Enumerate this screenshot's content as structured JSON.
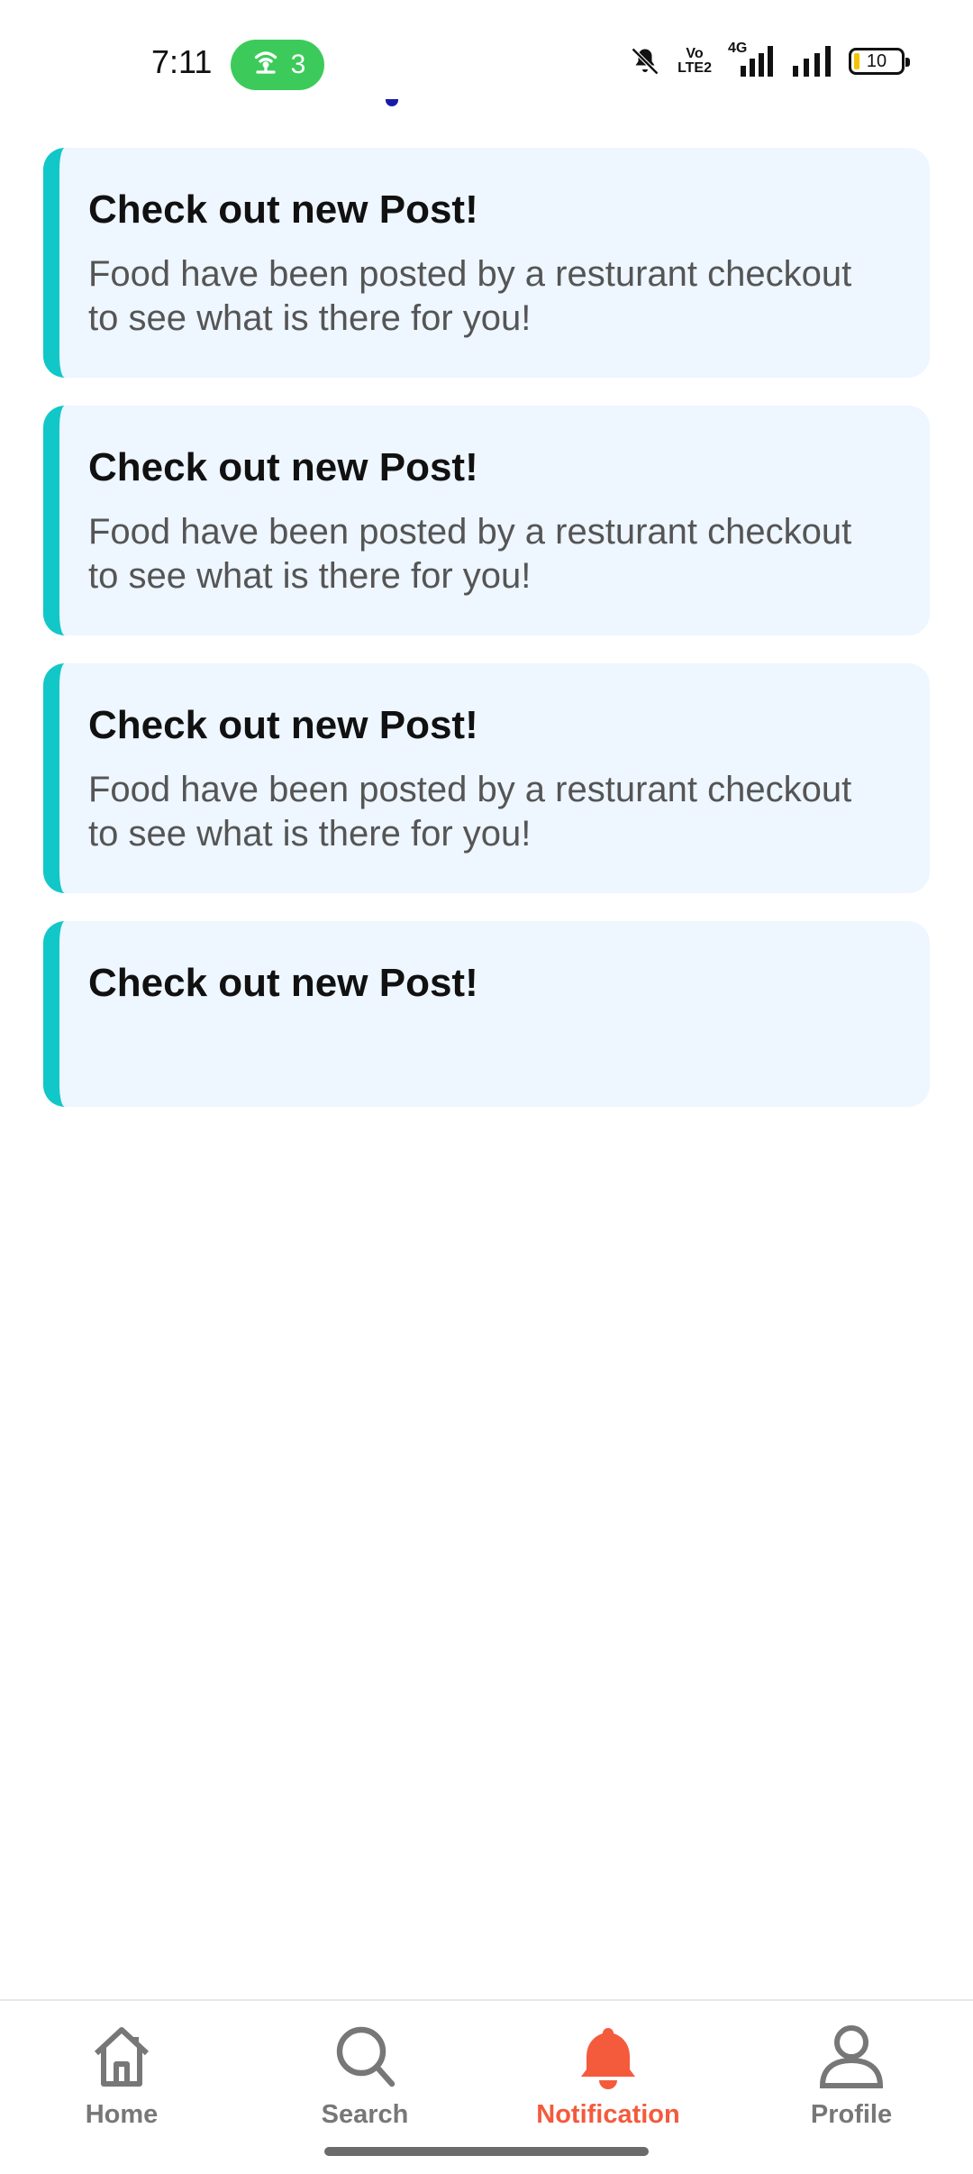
{
  "status_bar": {
    "time": "7:11",
    "hotspot_count": "3",
    "network_label": "4G",
    "volte_top": "Vo",
    "volte_bottom": "LTE2",
    "battery_level": "10"
  },
  "notifications": [
    {
      "title": "Check out new Post!",
      "body": "Food have been posted by a resturant checkout to see what is there for you!"
    },
    {
      "title": "Check out new Post!",
      "body": "Food have been posted by a resturant checkout to see what is there for you!"
    },
    {
      "title": "Check out new Post!",
      "body": "Food have been posted by a resturant checkout to see what is there for you!"
    },
    {
      "title": "Check out new Post!",
      "body": ""
    }
  ],
  "bottom_nav": {
    "items": [
      {
        "label": "Home",
        "icon": "home-icon"
      },
      {
        "label": "Search",
        "icon": "search-icon"
      },
      {
        "label": "Notification",
        "icon": "bell-icon"
      },
      {
        "label": "Profile",
        "icon": "profile-icon"
      }
    ],
    "active": "Notification"
  },
  "colors": {
    "accent": "#12c7c8",
    "active_nav": "#f45a3c",
    "card_bg": "#eef6ff",
    "hotspot_pill": "#3ccb5b"
  }
}
